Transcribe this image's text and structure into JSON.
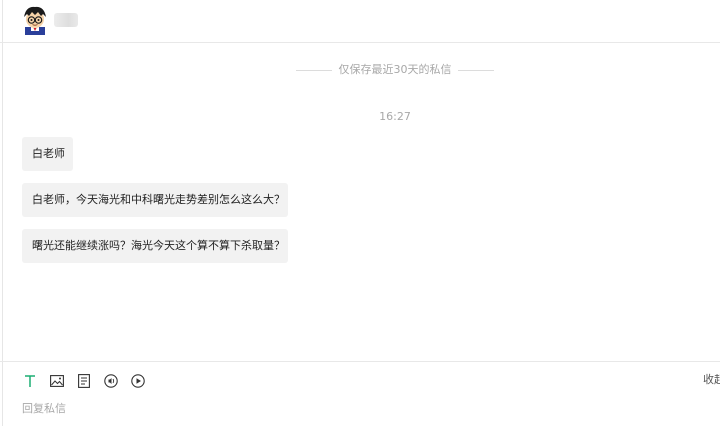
{
  "header": {
    "avatar_icon": "cartoon-avatar-icon",
    "username": "■■"
  },
  "chat": {
    "notice": "仅保存最近30天的私信",
    "timestamp": "16:27",
    "messages": [
      {
        "text": "白老师"
      },
      {
        "text": "白老师，今天海光和中科曙光走势差别怎么这么大？"
      },
      {
        "text": "曙光还能继续涨吗？海光今天这个算不算下杀取量？"
      }
    ]
  },
  "composer": {
    "tools": [
      {
        "icon": "text-format-icon",
        "color": "#1aad73"
      },
      {
        "icon": "image-icon"
      },
      {
        "icon": "document-icon"
      },
      {
        "icon": "audio-icon"
      },
      {
        "icon": "video-play-icon"
      }
    ],
    "collapse_label": "收起",
    "placeholder": "回复私信"
  }
}
